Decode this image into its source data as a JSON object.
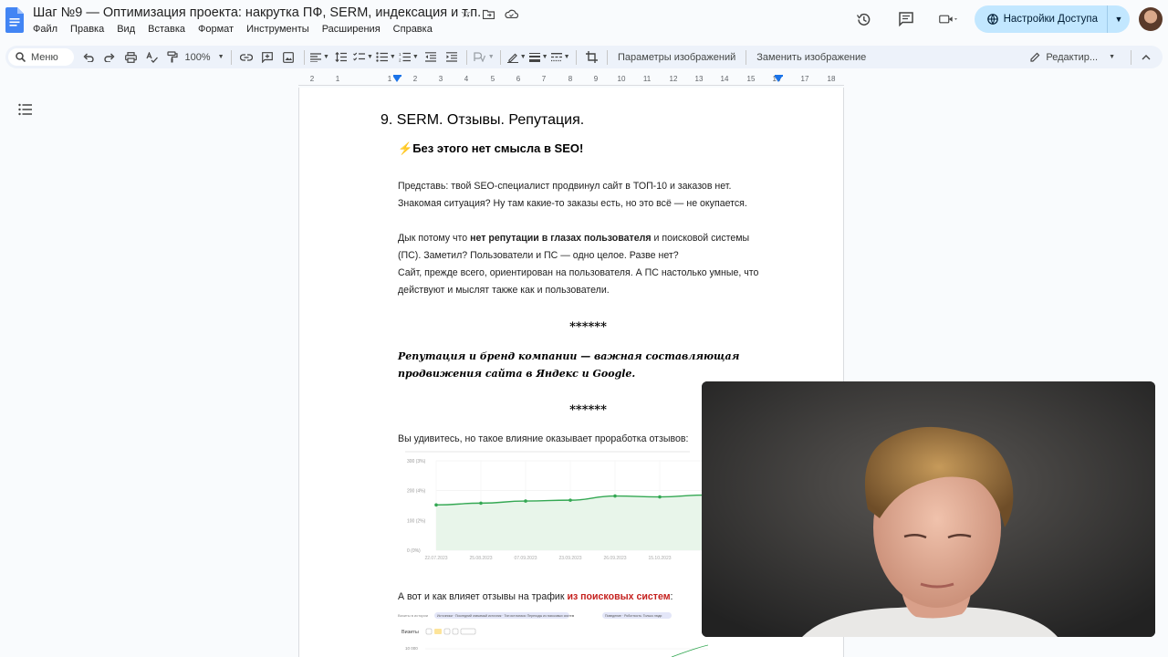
{
  "doc": {
    "title": "Шаг №9 — Оптимизация проекта: накрутка ПФ, SERM, индексация и т.п.",
    "menu": [
      "Файл",
      "Правка",
      "Вид",
      "Вставка",
      "Формат",
      "Инструменты",
      "Расширения",
      "Справка"
    ],
    "share_label": "Настройки Доступа"
  },
  "toolbar": {
    "menu_search": "Меню",
    "zoom": "100%",
    "image_options": "Параметры изображений",
    "replace_image": "Заменить изображение",
    "editing_mode": "Редактир..."
  },
  "ruler": {
    "labels": [
      "2",
      "1",
      "1",
      "2",
      "3",
      "4",
      "5",
      "6",
      "7",
      "8",
      "9",
      "10",
      "11",
      "12",
      "13",
      "14",
      "15",
      "16",
      "17",
      "18"
    ]
  },
  "content": {
    "heading": "9. SERM. Отзывы. Репутация.",
    "bolt_icon": "⚡",
    "subheading": "Без этого нет смысла в SEO!",
    "p1_l1": "Представь: твой SEO-специалист продвинул сайт в ТОП-10 и заказов нет.",
    "p1_l2": "Знакомая ситуация? Ну там какие-то заказы есть, но это всё — не окупается.",
    "p2_a": "Дык потому что ",
    "p2_bold": "нет репутации в глазах пользователя",
    "p2_b": " и поисковой системы",
    "p2_l2": "(ПС). Заметил? Пользователи и ПС — одно целое. Разве нет?",
    "p2_l3": "Сайт, прежде всего, ориентирован на пользователя. А ПС настолько умные, что",
    "p2_l4": "действуют и мыслят также как и пользователи.",
    "stars": "******",
    "quote": "Репутация и бренд компании — важная составляющая продвижения сайта в Яндекс и Google.",
    "p3": "Вы удивитесь, но такое влияние оказывает проработка отзывов:",
    "p4_a": "А вот и как влияет отзывы на трафик ",
    "p4_red": "из поисковых систем",
    "p4_b": ":"
  },
  "chart_data": {
    "type": "line",
    "x": [
      "22.07.2023",
      "25.08.2023",
      "07.09.2023",
      "23.09.2023",
      "26.09.2023",
      "15.10.2023",
      ""
    ],
    "series": [
      {
        "values": [
          152,
          158,
          165,
          168,
          182,
          179,
          185
        ]
      }
    ],
    "yticks": [
      "300 (3%)",
      "200 (4%)",
      "100 (2%)",
      "0 (0%)"
    ],
    "ylim": [
      0,
      300
    ],
    "color": "#34a853",
    "grid": true
  },
  "chart2": {
    "legend_label": "Визиты в истории",
    "chip1": "Источники · Последний значимый источник · Тип источника: Переходы из поисковых систем",
    "chip2": "Поведение · Роботность: Только люди",
    "metric": "Визиты",
    "y_top": "10 000"
  }
}
